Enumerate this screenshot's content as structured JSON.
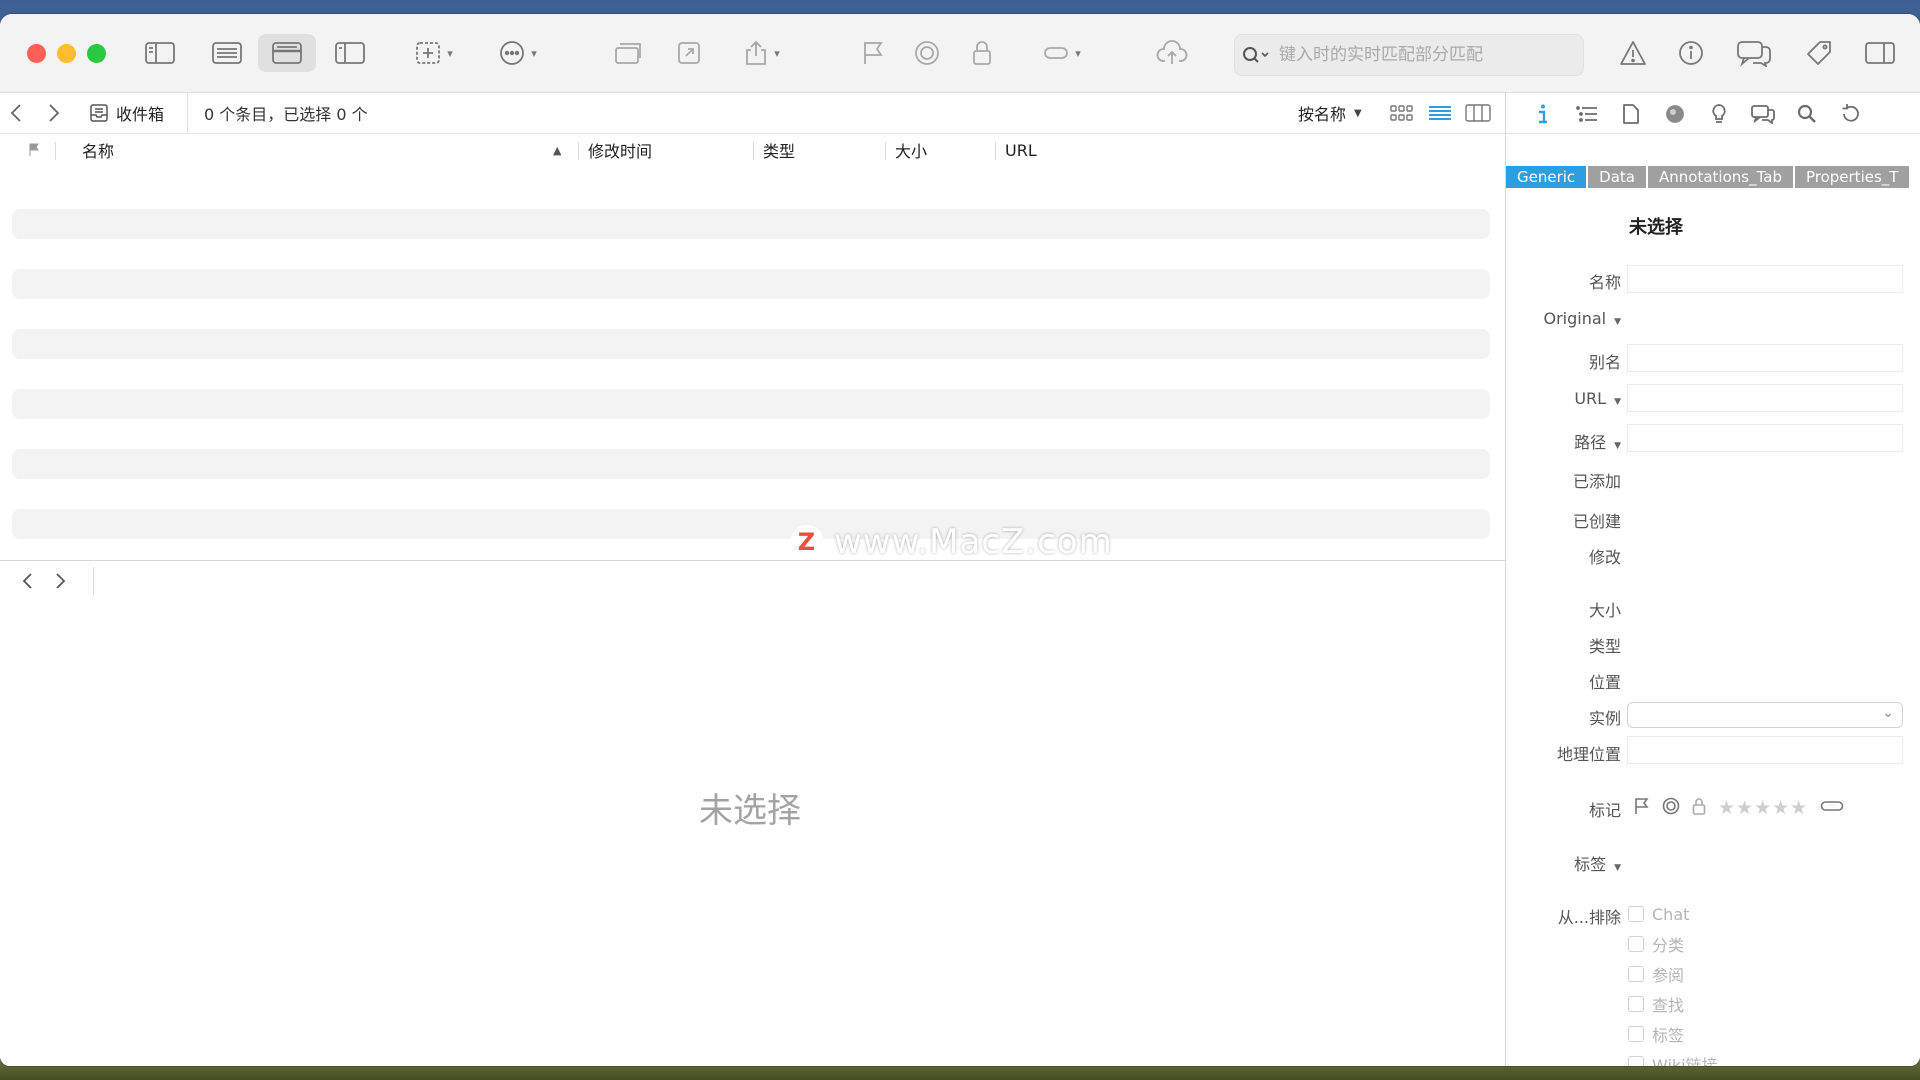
{
  "toolbar": {
    "search_placeholder": "键入时的实时匹配部分匹配"
  },
  "pathbar": {
    "location": "收件箱",
    "status": "0 个条目，已选择 0 个",
    "sort_label": "按名称"
  },
  "columns": {
    "name": "名称",
    "modified": "修改时间",
    "type": "类型",
    "size": "大小",
    "url": "URL"
  },
  "preview": {
    "empty_message": "未选择"
  },
  "watermark": {
    "logo_letter": "Z",
    "text": "www.MacZ.com"
  },
  "inspector": {
    "tabs": [
      "Generic",
      "Data",
      "Annotations_Tab",
      "Properties_T"
    ],
    "title": "未选择",
    "labels": {
      "name": "名称",
      "original": "Original",
      "alias": "别名",
      "url": "URL",
      "path": "路径",
      "added": "已添加",
      "created": "已创建",
      "modified": "修改",
      "size": "大小",
      "type": "类型",
      "location": "位置",
      "instance": "实例",
      "geo": "地理位置",
      "marks": "标记",
      "tags": "标签",
      "exclude": "从...排除"
    },
    "rating_stars": "★★★★★",
    "exclude_options": [
      "Chat",
      "分类",
      "参阅",
      "查找",
      "标签",
      "Wiki链接"
    ]
  },
  "colors": {
    "accent": "#2d9ee0",
    "close": "#fe5f57",
    "minimize": "#febc2e",
    "zoom": "#28c840"
  }
}
